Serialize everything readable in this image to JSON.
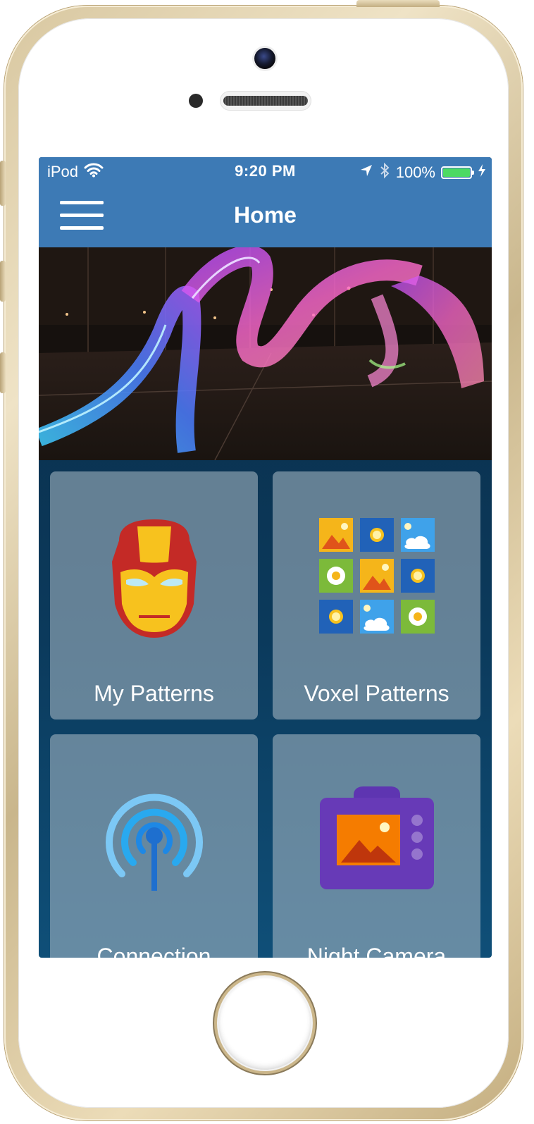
{
  "status_bar": {
    "carrier": "iPod",
    "time": "9:20 PM",
    "battery_percent": "100%",
    "battery_level": 1.0,
    "icons": [
      "wifi-icon",
      "location-arrow-icon",
      "bluetooth-icon",
      "battery-icon",
      "charging-bolt-icon"
    ]
  },
  "nav": {
    "title": "Home",
    "menu_icon": "hamburger-menu-icon"
  },
  "hero": {
    "image": "light-painting-photo"
  },
  "tiles": [
    {
      "label": "My Patterns",
      "icon": "iron-man-mask-icon"
    },
    {
      "label": "Voxel Patterns",
      "icon": "image-grid-icon"
    },
    {
      "label": "Connection",
      "icon": "broadcast-antenna-icon"
    },
    {
      "label": "Night Camera",
      "icon": "camera-photo-icon"
    }
  ],
  "colors": {
    "header": "#3d7ab5",
    "screen_background": "#0b3a5c",
    "tile": "#8fa4b3",
    "battery": "#4cd964"
  }
}
